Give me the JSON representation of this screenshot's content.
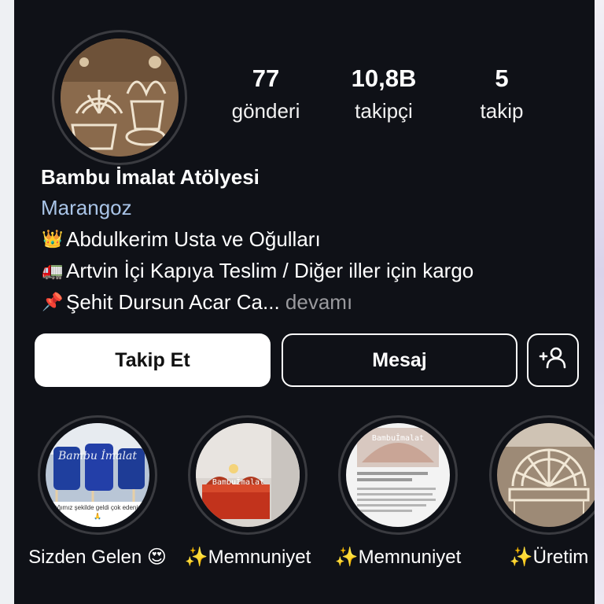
{
  "profile": {
    "name": "Bambu İmalat Atölyesi",
    "category": "Marangoz",
    "bio": [
      {
        "emoji": "👑",
        "icon": "crown-icon",
        "text": "Abdulkerim Usta ve Oğulları"
      },
      {
        "emoji": "🚛",
        "icon": "truck-icon",
        "text": "Artvin İçi Kapıya Teslim / Diğer iller için kargo"
      },
      {
        "emoji": "📌",
        "icon": "pin-icon",
        "text": "Şehit Dursun Acar Ca..."
      }
    ],
    "more_label": " devamı"
  },
  "stats": [
    {
      "value": "77",
      "label": "gönderi"
    },
    {
      "value": "10,8B",
      "label": "takipçi"
    },
    {
      "value": "5",
      "label": "takip"
    }
  ],
  "actions": {
    "follow": "Takip Et",
    "message": "Mesaj",
    "add_icon": "add-person-icon"
  },
  "highlights": [
    {
      "label": "Sizden Gelen 😍",
      "overlay": "Bambu İmalat",
      "caption": "dığımız şekilde geldi çok edenim 🙏"
    },
    {
      "label": "✨Memnuniyet",
      "overlay": "Bambuİmalat"
    },
    {
      "label": "✨Memnuniyet",
      "overlay": "Bambuİmalat"
    },
    {
      "label": "✨Üretim"
    }
  ],
  "colors": {
    "background": "#0f1117",
    "category": "#a9c4e7",
    "muted": "#9a9a9e",
    "ring": "#3a3b40"
  }
}
